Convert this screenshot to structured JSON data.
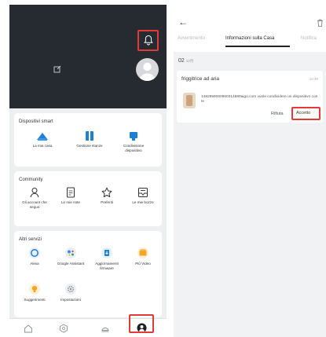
{
  "left": {
    "smart": {
      "title": "Dispositivi smart",
      "items": [
        {
          "label": "La mia casa",
          "icon": "cloud-house-icon"
        },
        {
          "label": "Gestione stanze",
          "icon": "room-management-icon"
        },
        {
          "label": "Condivisione dispositivo",
          "icon": "device-sharing-icon"
        }
      ]
    },
    "community": {
      "title": "Community",
      "items": [
        {
          "label": "Gli account che seguo",
          "icon": "person-icon"
        },
        {
          "label": "Le mie note",
          "icon": "notes-icon"
        },
        {
          "label": "Preferiti",
          "icon": "star-icon"
        },
        {
          "label": "Le mie bozze",
          "icon": "drafts-icon"
        }
      ]
    },
    "other": {
      "title": "Altri servizi",
      "items": [
        {
          "label": "Alexa",
          "icon": "alexa-icon"
        },
        {
          "label": "Google Assistant",
          "icon": "google-assistant-icon"
        },
        {
          "label": "Aggiornamenti firmware",
          "icon": "firmware-update-icon"
        },
        {
          "label": "Più Video",
          "icon": "video-icon"
        },
        {
          "label": "Suggerimenti",
          "icon": "lightbulb-icon"
        },
        {
          "label": "Impostazioni",
          "icon": "settings-gear-icon"
        }
      ]
    },
    "tabbar": [
      "home-tab-icon",
      "device-tab-icon",
      "mall-tab-icon",
      "me-tab-icon"
    ],
    "colors": {
      "header": "#262a31",
      "accent": "#1e7fd6",
      "highlight": "#e53935"
    }
  },
  "right": {
    "tabs": [
      "Avvertimento",
      "Informazioni sulla Casa",
      "Notifica"
    ],
    "date": "02",
    "date_sub": "12月",
    "message": {
      "title": "friggitrice ad aria",
      "time": "10:30",
      "body": "1482958060960314880aigo.com vuole condividere un dispositivo con te",
      "reject": "Rifiuta",
      "accept": "Accetto"
    }
  }
}
